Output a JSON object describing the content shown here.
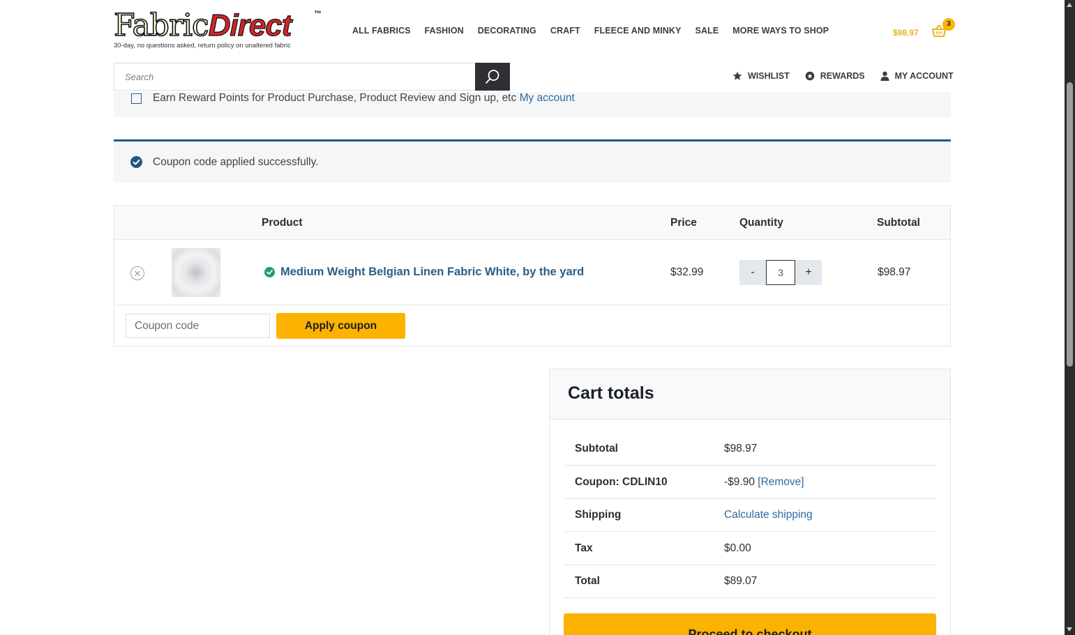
{
  "brand": {
    "logo_part1": "Fabric",
    "logo_part2": "Direct",
    "trademark": "™",
    "tagline": "30-day, no questions asked, return policy on unaltered fabric"
  },
  "main_nav": [
    "ALL FABRICS",
    "FASHION",
    "DECORATING",
    "CRAFT",
    "FLEECE AND MINKY",
    "SALE",
    "MORE WAYS TO SHOP"
  ],
  "mini_cart": {
    "amount": "$98.97",
    "count": "3"
  },
  "search": {
    "placeholder": "Search"
  },
  "account_nav": {
    "wishlist": "WISHLIST",
    "rewards": "REWARDS",
    "my_account": "MY ACCOUNT"
  },
  "reward_notice": {
    "text": "Earn Reward Points for Product Purchase, Product Review and Sign up, etc",
    "link": "My account"
  },
  "success_notice": {
    "text": "Coupon code applied successfully."
  },
  "cart_table": {
    "headers": {
      "product": "Product",
      "price": "Price",
      "quantity": "Quantity",
      "subtotal": "Subtotal"
    },
    "items": [
      {
        "name": "Medium Weight Belgian Linen Fabric White, by the yard",
        "price": "$32.99",
        "quantity": "3",
        "subtotal": "$98.97"
      }
    ],
    "qty_minus": "-",
    "qty_plus": "+",
    "remove_symbol": "✕",
    "coupon_placeholder": "Coupon code",
    "apply_label": "Apply coupon"
  },
  "cart_totals": {
    "title": "Cart totals",
    "rows": [
      {
        "label": "Subtotal",
        "value": "$98.97"
      },
      {
        "label": "Coupon: CDLIN10",
        "value": "-$9.90",
        "link": "[Remove]"
      },
      {
        "label": "Shipping",
        "link": "Calculate shipping"
      },
      {
        "label": "Tax",
        "value": "$0.00"
      },
      {
        "label": "Total",
        "value": "$89.07"
      }
    ],
    "checkout_label": "Proceed to checkout"
  },
  "colors": {
    "accent": "#fbb200",
    "link": "#2a5e87",
    "notice_border": "#23577f",
    "success_check": "#1e9e6e"
  }
}
